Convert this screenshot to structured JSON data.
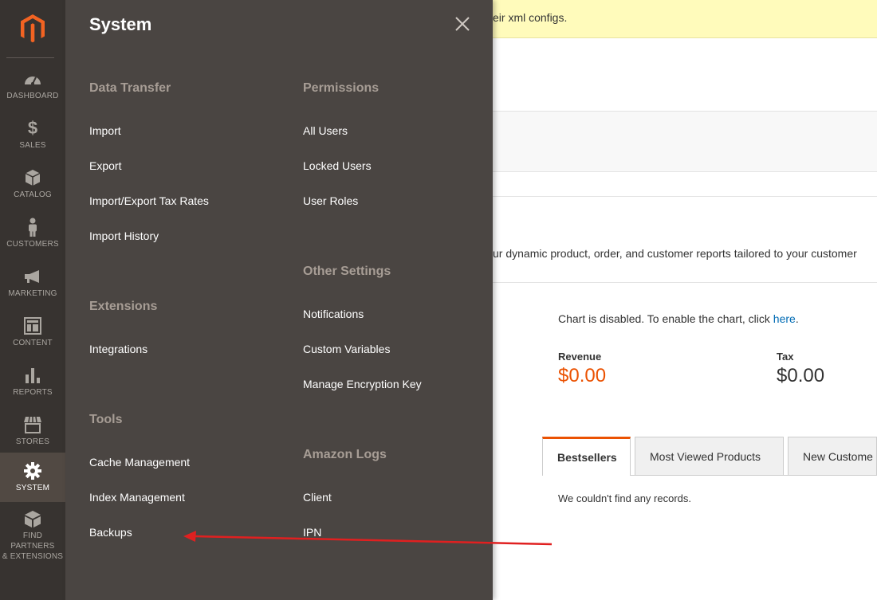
{
  "nav": {
    "items": [
      {
        "key": "dashboard",
        "label": "DASHBOARD",
        "icon": "dashboard-gauge-icon"
      },
      {
        "key": "sales",
        "label": "SALES",
        "icon": "dollar-icon"
      },
      {
        "key": "catalog",
        "label": "CATALOG",
        "icon": "box-icon"
      },
      {
        "key": "customers",
        "label": "CUSTOMERS",
        "icon": "person-icon"
      },
      {
        "key": "marketing",
        "label": "MARKETING",
        "icon": "megaphone-icon"
      },
      {
        "key": "content",
        "label": "CONTENT",
        "icon": "layout-icon"
      },
      {
        "key": "reports",
        "label": "REPORTS",
        "icon": "bar-chart-icon"
      },
      {
        "key": "stores",
        "label": "STORES",
        "icon": "storefront-icon"
      },
      {
        "key": "system",
        "label": "SYSTEM",
        "icon": "gear-icon"
      },
      {
        "key": "partners",
        "label_line1": "FIND PARTNERS",
        "label_line2": "& EXTENSIONS",
        "icon": "blocks-icon"
      }
    ],
    "active": "system"
  },
  "page": {
    "notice_text": "eir xml configs.",
    "advanced_text": "ur dynamic product, order, and customer reports tailored to your customer",
    "chart_msg": "Chart is disabled. To enable the chart, click ",
    "chart_link": "here",
    "chart_msg_end": ".",
    "revenue_label": "Revenue",
    "revenue_value": "$0.00",
    "tax_label": "Tax",
    "tax_value": "$0.00",
    "tabs": [
      "Bestsellers",
      "Most Viewed Products",
      "New Custome"
    ],
    "no_records": "We couldn't find any records."
  },
  "flyout": {
    "title": "System",
    "col1": [
      {
        "heading": "Data Transfer",
        "links": [
          "Import",
          "Export",
          "Import/Export Tax Rates",
          "Import History"
        ]
      },
      {
        "heading": "Extensions",
        "links": [
          "Integrations"
        ]
      },
      {
        "heading": "Tools",
        "links": [
          "Cache Management",
          "Index Management",
          "Backups"
        ]
      }
    ],
    "col2": [
      {
        "heading": "Permissions",
        "links": [
          "All Users",
          "Locked Users",
          "User Roles"
        ]
      },
      {
        "heading": "Other Settings",
        "links": [
          "Notifications",
          "Custom Variables",
          "Manage Encryption Key"
        ]
      },
      {
        "heading": "Amazon Logs",
        "links": [
          "Client",
          "IPN"
        ]
      }
    ]
  },
  "colors": {
    "accent": "#eb5202",
    "nav_bg": "#373330",
    "flyout_bg": "#4a4542",
    "annotation": "#e02020"
  }
}
